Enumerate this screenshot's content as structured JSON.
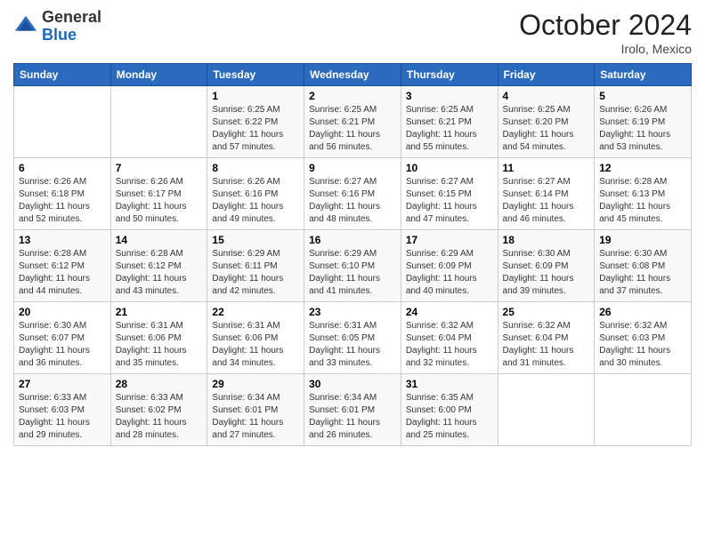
{
  "logo": {
    "general": "General",
    "blue": "Blue"
  },
  "header": {
    "month": "October 2024",
    "location": "Irolo, Mexico"
  },
  "weekdays": [
    "Sunday",
    "Monday",
    "Tuesday",
    "Wednesday",
    "Thursday",
    "Friday",
    "Saturday"
  ],
  "weeks": [
    [
      {
        "day": "",
        "sunrise": "",
        "sunset": "",
        "daylight": ""
      },
      {
        "day": "",
        "sunrise": "",
        "sunset": "",
        "daylight": ""
      },
      {
        "day": "1",
        "sunrise": "Sunrise: 6:25 AM",
        "sunset": "Sunset: 6:22 PM",
        "daylight": "Daylight: 11 hours and 57 minutes."
      },
      {
        "day": "2",
        "sunrise": "Sunrise: 6:25 AM",
        "sunset": "Sunset: 6:21 PM",
        "daylight": "Daylight: 11 hours and 56 minutes."
      },
      {
        "day": "3",
        "sunrise": "Sunrise: 6:25 AM",
        "sunset": "Sunset: 6:21 PM",
        "daylight": "Daylight: 11 hours and 55 minutes."
      },
      {
        "day": "4",
        "sunrise": "Sunrise: 6:25 AM",
        "sunset": "Sunset: 6:20 PM",
        "daylight": "Daylight: 11 hours and 54 minutes."
      },
      {
        "day": "5",
        "sunrise": "Sunrise: 6:26 AM",
        "sunset": "Sunset: 6:19 PM",
        "daylight": "Daylight: 11 hours and 53 minutes."
      }
    ],
    [
      {
        "day": "6",
        "sunrise": "Sunrise: 6:26 AM",
        "sunset": "Sunset: 6:18 PM",
        "daylight": "Daylight: 11 hours and 52 minutes."
      },
      {
        "day": "7",
        "sunrise": "Sunrise: 6:26 AM",
        "sunset": "Sunset: 6:17 PM",
        "daylight": "Daylight: 11 hours and 50 minutes."
      },
      {
        "day": "8",
        "sunrise": "Sunrise: 6:26 AM",
        "sunset": "Sunset: 6:16 PM",
        "daylight": "Daylight: 11 hours and 49 minutes."
      },
      {
        "day": "9",
        "sunrise": "Sunrise: 6:27 AM",
        "sunset": "Sunset: 6:16 PM",
        "daylight": "Daylight: 11 hours and 48 minutes."
      },
      {
        "day": "10",
        "sunrise": "Sunrise: 6:27 AM",
        "sunset": "Sunset: 6:15 PM",
        "daylight": "Daylight: 11 hours and 47 minutes."
      },
      {
        "day": "11",
        "sunrise": "Sunrise: 6:27 AM",
        "sunset": "Sunset: 6:14 PM",
        "daylight": "Daylight: 11 hours and 46 minutes."
      },
      {
        "day": "12",
        "sunrise": "Sunrise: 6:28 AM",
        "sunset": "Sunset: 6:13 PM",
        "daylight": "Daylight: 11 hours and 45 minutes."
      }
    ],
    [
      {
        "day": "13",
        "sunrise": "Sunrise: 6:28 AM",
        "sunset": "Sunset: 6:12 PM",
        "daylight": "Daylight: 11 hours and 44 minutes."
      },
      {
        "day": "14",
        "sunrise": "Sunrise: 6:28 AM",
        "sunset": "Sunset: 6:12 PM",
        "daylight": "Daylight: 11 hours and 43 minutes."
      },
      {
        "day": "15",
        "sunrise": "Sunrise: 6:29 AM",
        "sunset": "Sunset: 6:11 PM",
        "daylight": "Daylight: 11 hours and 42 minutes."
      },
      {
        "day": "16",
        "sunrise": "Sunrise: 6:29 AM",
        "sunset": "Sunset: 6:10 PM",
        "daylight": "Daylight: 11 hours and 41 minutes."
      },
      {
        "day": "17",
        "sunrise": "Sunrise: 6:29 AM",
        "sunset": "Sunset: 6:09 PM",
        "daylight": "Daylight: 11 hours and 40 minutes."
      },
      {
        "day": "18",
        "sunrise": "Sunrise: 6:30 AM",
        "sunset": "Sunset: 6:09 PM",
        "daylight": "Daylight: 11 hours and 39 minutes."
      },
      {
        "day": "19",
        "sunrise": "Sunrise: 6:30 AM",
        "sunset": "Sunset: 6:08 PM",
        "daylight": "Daylight: 11 hours and 37 minutes."
      }
    ],
    [
      {
        "day": "20",
        "sunrise": "Sunrise: 6:30 AM",
        "sunset": "Sunset: 6:07 PM",
        "daylight": "Daylight: 11 hours and 36 minutes."
      },
      {
        "day": "21",
        "sunrise": "Sunrise: 6:31 AM",
        "sunset": "Sunset: 6:06 PM",
        "daylight": "Daylight: 11 hours and 35 minutes."
      },
      {
        "day": "22",
        "sunrise": "Sunrise: 6:31 AM",
        "sunset": "Sunset: 6:06 PM",
        "daylight": "Daylight: 11 hours and 34 minutes."
      },
      {
        "day": "23",
        "sunrise": "Sunrise: 6:31 AM",
        "sunset": "Sunset: 6:05 PM",
        "daylight": "Daylight: 11 hours and 33 minutes."
      },
      {
        "day": "24",
        "sunrise": "Sunrise: 6:32 AM",
        "sunset": "Sunset: 6:04 PM",
        "daylight": "Daylight: 11 hours and 32 minutes."
      },
      {
        "day": "25",
        "sunrise": "Sunrise: 6:32 AM",
        "sunset": "Sunset: 6:04 PM",
        "daylight": "Daylight: 11 hours and 31 minutes."
      },
      {
        "day": "26",
        "sunrise": "Sunrise: 6:32 AM",
        "sunset": "Sunset: 6:03 PM",
        "daylight": "Daylight: 11 hours and 30 minutes."
      }
    ],
    [
      {
        "day": "27",
        "sunrise": "Sunrise: 6:33 AM",
        "sunset": "Sunset: 6:03 PM",
        "daylight": "Daylight: 11 hours and 29 minutes."
      },
      {
        "day": "28",
        "sunrise": "Sunrise: 6:33 AM",
        "sunset": "Sunset: 6:02 PM",
        "daylight": "Daylight: 11 hours and 28 minutes."
      },
      {
        "day": "29",
        "sunrise": "Sunrise: 6:34 AM",
        "sunset": "Sunset: 6:01 PM",
        "daylight": "Daylight: 11 hours and 27 minutes."
      },
      {
        "day": "30",
        "sunrise": "Sunrise: 6:34 AM",
        "sunset": "Sunset: 6:01 PM",
        "daylight": "Daylight: 11 hours and 26 minutes."
      },
      {
        "day": "31",
        "sunrise": "Sunrise: 6:35 AM",
        "sunset": "Sunset: 6:00 PM",
        "daylight": "Daylight: 11 hours and 25 minutes."
      },
      {
        "day": "",
        "sunrise": "",
        "sunset": "",
        "daylight": ""
      },
      {
        "day": "",
        "sunrise": "",
        "sunset": "",
        "daylight": ""
      }
    ]
  ]
}
